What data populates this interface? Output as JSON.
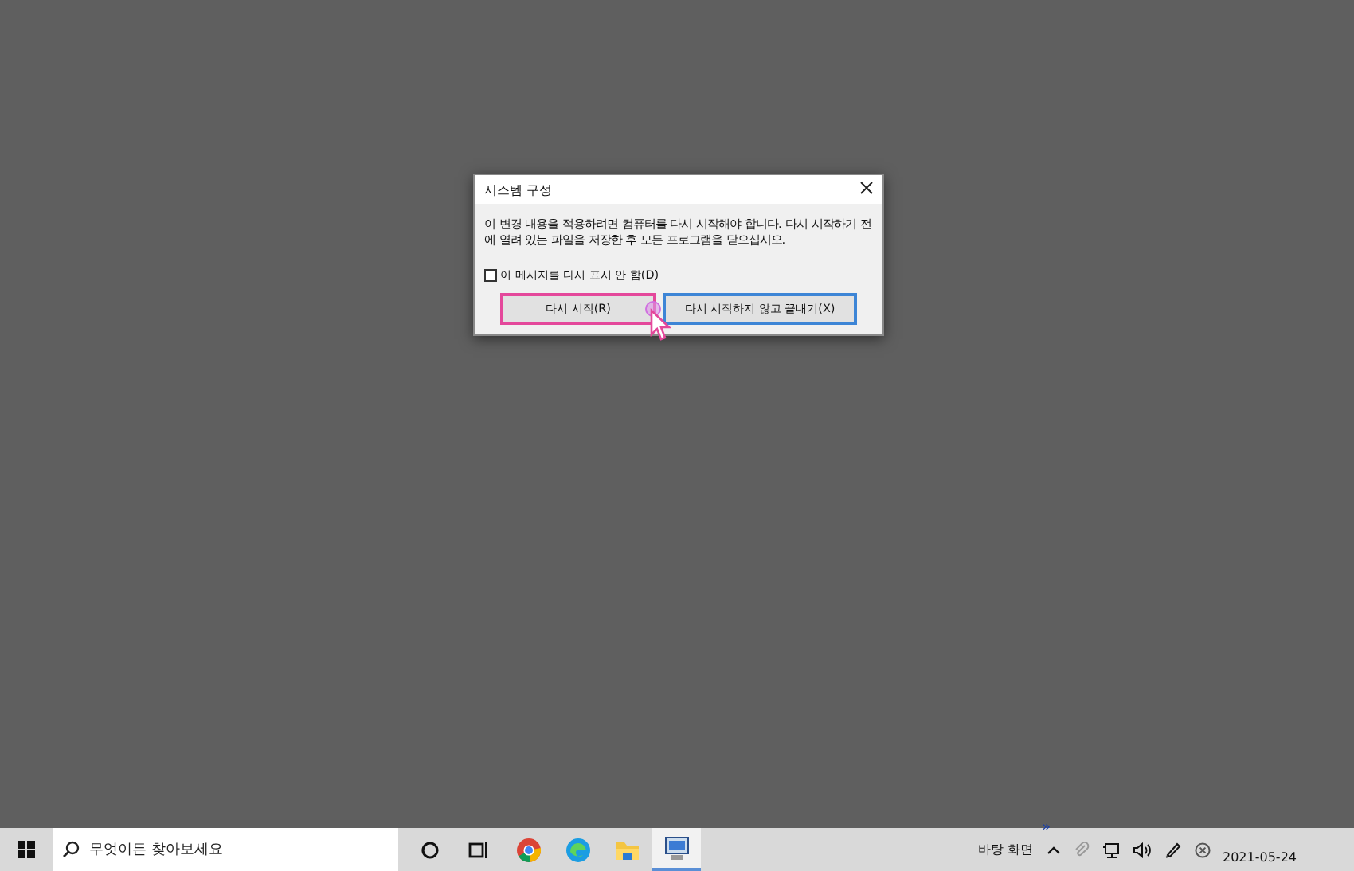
{
  "dialog": {
    "title": "시스템 구성",
    "message": "이 변경 내용을 적용하려면 컴퓨터를 다시 시작해야 합니다. 다시 시작하기 전에 열려 있는 파일을 저장한 후 모든 프로그램을 닫으십시오.",
    "checkbox": {
      "label": "이 메시지를 다시 표시 안 함(D)",
      "checked": false
    },
    "buttons": [
      {
        "label": "다시 시작(R)",
        "highlighted": true,
        "focused": false
      },
      {
        "label": "다시 시작하지 않고 끝내기(X)",
        "highlighted": false,
        "focused": true
      }
    ]
  },
  "taskbar": {
    "search": {
      "placeholder": "무엇이든 찾아보세요"
    },
    "apps": [
      {
        "kind": "cortana",
        "active": false
      },
      {
        "kind": "taskview",
        "active": false
      },
      {
        "kind": "chrome",
        "active": false
      },
      {
        "kind": "edge",
        "active": false
      },
      {
        "kind": "folder",
        "active": false
      },
      {
        "kind": "sysconfig",
        "active": true
      }
    ],
    "desktop_label": "바탕 화면",
    "chevron": "»",
    "date": "2021-05-24"
  }
}
